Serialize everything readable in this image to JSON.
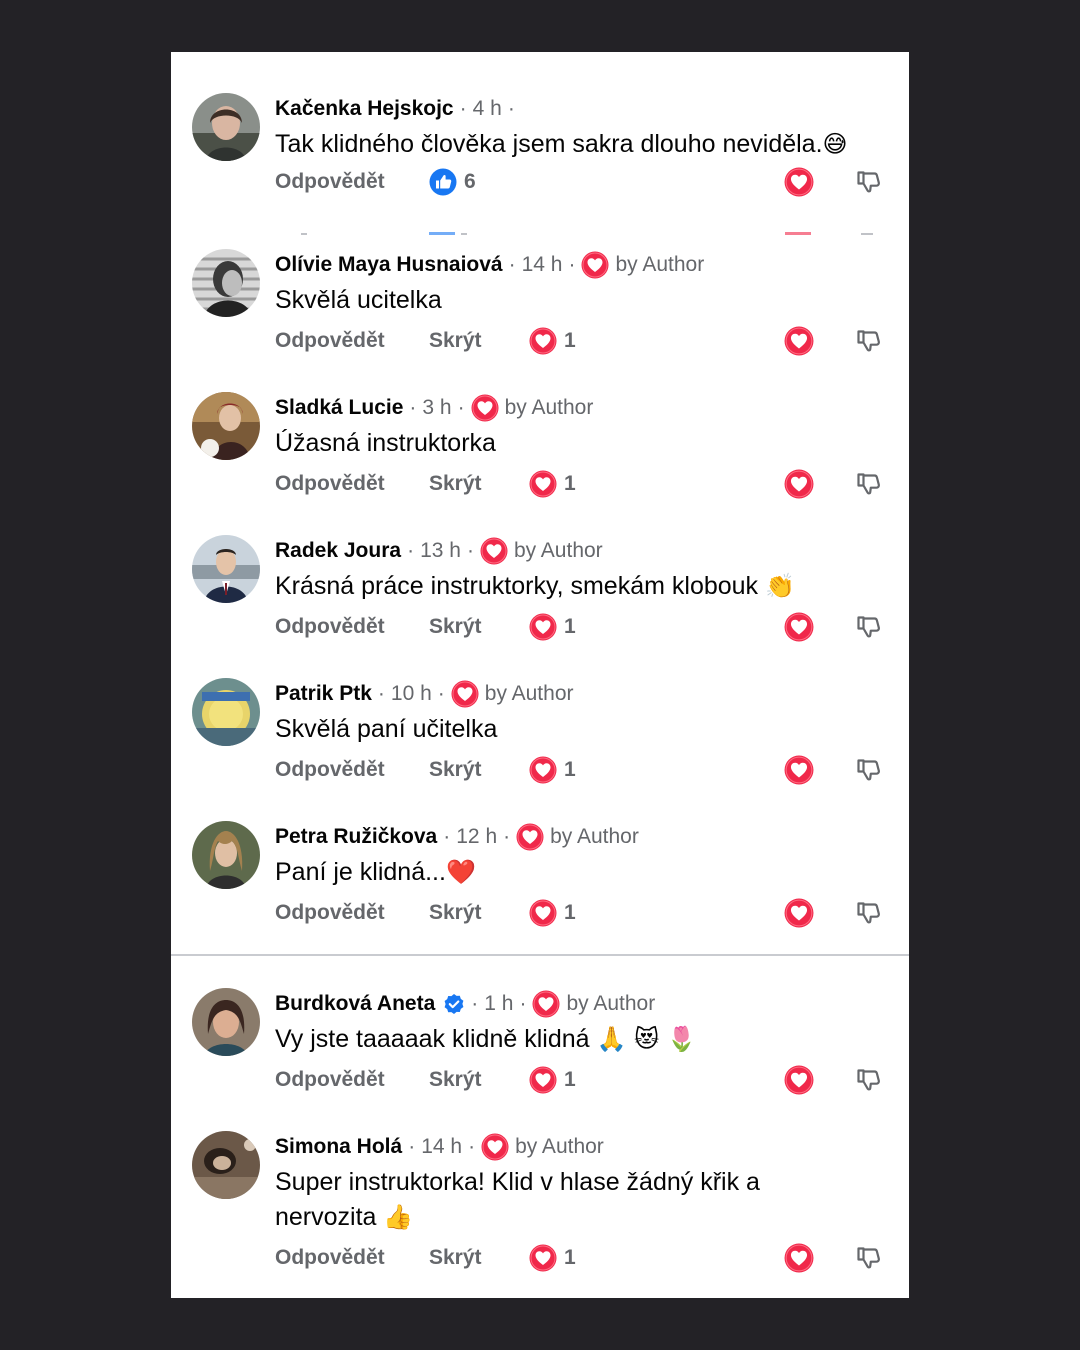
{
  "colors": {
    "background": "#232226",
    "panel": "#ffffff",
    "name_text": "#050505",
    "secondary_text": "#65676b",
    "heart_red": "#f0284a",
    "like_blue": "#1877f2"
  },
  "icons": {
    "love_reaction": "heart-icon",
    "like_reaction": "thumbs-up-icon",
    "dislike": "thumbs-down-icon",
    "verified": "verified-badge-icon"
  },
  "comments": [
    {
      "name": "Kačenka Hejskojc",
      "time": "4 h",
      "text": "Tak klidného člověka jsem sakra dlouho neviděla.",
      "emoji": "😅",
      "reply_label": "Odpovědět",
      "reaction_count": "6"
    },
    {
      "name": "Olívie Maya Husnaiová",
      "time": "14 h",
      "by_author": "by Author",
      "text": "Skvělá ucitelka",
      "reply_label": "Odpovědět",
      "hide_label": "Skrýt",
      "reaction_count": "1"
    },
    {
      "name": "Sladká Lucie",
      "time": "3 h",
      "by_author": "by Author",
      "text": "Úžasná instruktorka",
      "reply_label": "Odpovědět",
      "hide_label": "Skrýt",
      "reaction_count": "1"
    },
    {
      "name": "Radek Joura",
      "time": "13 h",
      "by_author": "by Author",
      "text": "Krásná práce instruktorky, smekám klobouk ",
      "emoji": "👏",
      "reply_label": "Odpovědět",
      "hide_label": "Skrýt",
      "reaction_count": "1"
    },
    {
      "name": "Patrik Ptk",
      "time": "10 h",
      "by_author": "by Author",
      "text": "Skvělá paní učitelka",
      "reply_label": "Odpovědět",
      "hide_label": "Skrýt",
      "reaction_count": "1"
    },
    {
      "name": "Petra Ružičkova",
      "time": "12 h",
      "by_author": "by Author",
      "text": "Paní je klidná...",
      "emoji": "❤️",
      "reply_label": "Odpovědět",
      "hide_label": "Skrýt",
      "reaction_count": "1"
    },
    {
      "name": "Burdková Aneta",
      "time": "1 h",
      "by_author": "by Author",
      "verified": true,
      "text": "Vy jste taaaaak klidně klidná ",
      "emoji": "🙏 😻 🌷",
      "reply_label": "Odpovědět",
      "hide_label": "Skrýt",
      "reaction_count": "1"
    },
    {
      "name": "Simona Holá",
      "time": "14 h",
      "by_author": "by Author",
      "text": "Super instruktorka! Klid v hlase žádný křik a nervozita ",
      "emoji": "👍",
      "reply_label": "Odpovědět",
      "hide_label": "Skrýt",
      "reaction_count": "1"
    }
  ]
}
